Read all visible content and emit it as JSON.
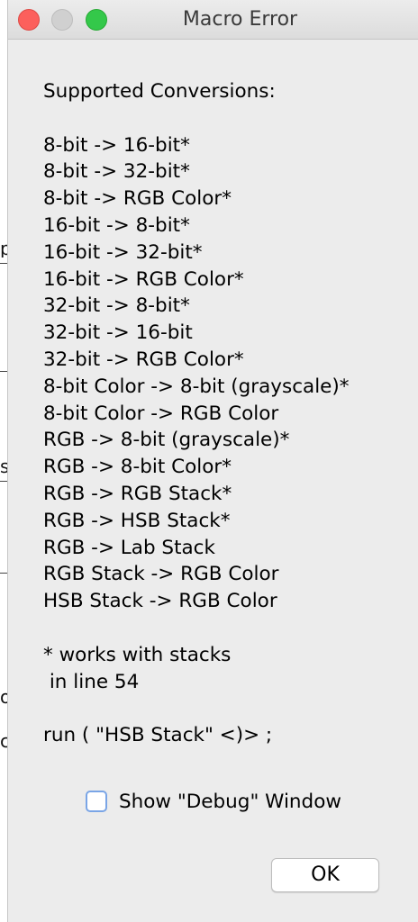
{
  "window": {
    "title": "Macro Error"
  },
  "message": {
    "heading": "Supported Conversions:",
    "conversions": [
      "8-bit -> 16-bit*",
      "8-bit -> 32-bit*",
      "8-bit -> RGB Color*",
      "16-bit -> 8-bit*",
      "16-bit -> 32-bit*",
      "16-bit -> RGB Color*",
      "32-bit -> 8-bit*",
      "32-bit -> 16-bit",
      "32-bit -> RGB Color*",
      "8-bit Color -> 8-bit (grayscale)*",
      "8-bit Color -> RGB Color",
      "RGB -> 8-bit (grayscale)*",
      "RGB -> 8-bit Color*",
      "RGB -> RGB Stack*",
      "RGB -> HSB Stack*",
      "RGB -> Lab Stack",
      "RGB Stack -> RGB Color",
      "HSB Stack -> RGB Color"
    ],
    "footnote": "* works with stacks",
    "line_info": " in line 54",
    "code": "run ( \"HSB Stack\" <)> ;"
  },
  "debug_checkbox": {
    "label": "Show \"Debug\" Window",
    "checked": false
  },
  "ok_button": {
    "label": "OK"
  },
  "colors": {
    "close": "#fc605c",
    "minimize": "#d0d0d0",
    "maximize": "#34c84a",
    "checkbox_border": "#7aa5e6"
  }
}
